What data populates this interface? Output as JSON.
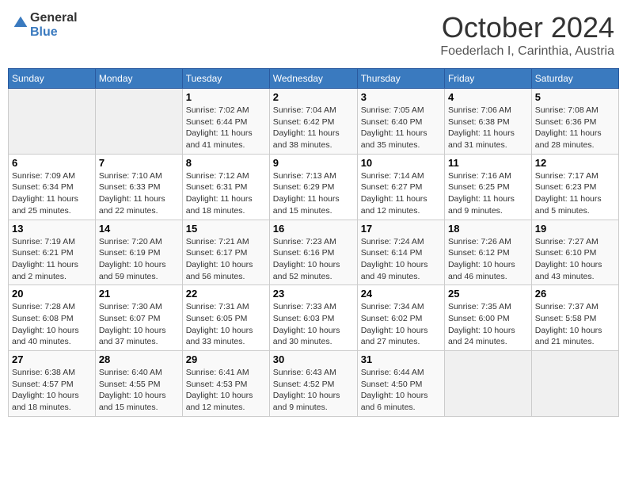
{
  "header": {
    "logo_general": "General",
    "logo_blue": "Blue",
    "month_title": "October 2024",
    "location": "Foederlach I, Carinthia, Austria"
  },
  "weekdays": [
    "Sunday",
    "Monday",
    "Tuesday",
    "Wednesday",
    "Thursday",
    "Friday",
    "Saturday"
  ],
  "weeks": [
    [
      {
        "day": "",
        "empty": true
      },
      {
        "day": "",
        "empty": true
      },
      {
        "day": "1",
        "sunrise": "Sunrise: 7:02 AM",
        "sunset": "Sunset: 6:44 PM",
        "daylight": "Daylight: 11 hours and 41 minutes."
      },
      {
        "day": "2",
        "sunrise": "Sunrise: 7:04 AM",
        "sunset": "Sunset: 6:42 PM",
        "daylight": "Daylight: 11 hours and 38 minutes."
      },
      {
        "day": "3",
        "sunrise": "Sunrise: 7:05 AM",
        "sunset": "Sunset: 6:40 PM",
        "daylight": "Daylight: 11 hours and 35 minutes."
      },
      {
        "day": "4",
        "sunrise": "Sunrise: 7:06 AM",
        "sunset": "Sunset: 6:38 PM",
        "daylight": "Daylight: 11 hours and 31 minutes."
      },
      {
        "day": "5",
        "sunrise": "Sunrise: 7:08 AM",
        "sunset": "Sunset: 6:36 PM",
        "daylight": "Daylight: 11 hours and 28 minutes."
      }
    ],
    [
      {
        "day": "6",
        "sunrise": "Sunrise: 7:09 AM",
        "sunset": "Sunset: 6:34 PM",
        "daylight": "Daylight: 11 hours and 25 minutes."
      },
      {
        "day": "7",
        "sunrise": "Sunrise: 7:10 AM",
        "sunset": "Sunset: 6:33 PM",
        "daylight": "Daylight: 11 hours and 22 minutes."
      },
      {
        "day": "8",
        "sunrise": "Sunrise: 7:12 AM",
        "sunset": "Sunset: 6:31 PM",
        "daylight": "Daylight: 11 hours and 18 minutes."
      },
      {
        "day": "9",
        "sunrise": "Sunrise: 7:13 AM",
        "sunset": "Sunset: 6:29 PM",
        "daylight": "Daylight: 11 hours and 15 minutes."
      },
      {
        "day": "10",
        "sunrise": "Sunrise: 7:14 AM",
        "sunset": "Sunset: 6:27 PM",
        "daylight": "Daylight: 11 hours and 12 minutes."
      },
      {
        "day": "11",
        "sunrise": "Sunrise: 7:16 AM",
        "sunset": "Sunset: 6:25 PM",
        "daylight": "Daylight: 11 hours and 9 minutes."
      },
      {
        "day": "12",
        "sunrise": "Sunrise: 7:17 AM",
        "sunset": "Sunset: 6:23 PM",
        "daylight": "Daylight: 11 hours and 5 minutes."
      }
    ],
    [
      {
        "day": "13",
        "sunrise": "Sunrise: 7:19 AM",
        "sunset": "Sunset: 6:21 PM",
        "daylight": "Daylight: 11 hours and 2 minutes."
      },
      {
        "day": "14",
        "sunrise": "Sunrise: 7:20 AM",
        "sunset": "Sunset: 6:19 PM",
        "daylight": "Daylight: 10 hours and 59 minutes."
      },
      {
        "day": "15",
        "sunrise": "Sunrise: 7:21 AM",
        "sunset": "Sunset: 6:17 PM",
        "daylight": "Daylight: 10 hours and 56 minutes."
      },
      {
        "day": "16",
        "sunrise": "Sunrise: 7:23 AM",
        "sunset": "Sunset: 6:16 PM",
        "daylight": "Daylight: 10 hours and 52 minutes."
      },
      {
        "day": "17",
        "sunrise": "Sunrise: 7:24 AM",
        "sunset": "Sunset: 6:14 PM",
        "daylight": "Daylight: 10 hours and 49 minutes."
      },
      {
        "day": "18",
        "sunrise": "Sunrise: 7:26 AM",
        "sunset": "Sunset: 6:12 PM",
        "daylight": "Daylight: 10 hours and 46 minutes."
      },
      {
        "day": "19",
        "sunrise": "Sunrise: 7:27 AM",
        "sunset": "Sunset: 6:10 PM",
        "daylight": "Daylight: 10 hours and 43 minutes."
      }
    ],
    [
      {
        "day": "20",
        "sunrise": "Sunrise: 7:28 AM",
        "sunset": "Sunset: 6:08 PM",
        "daylight": "Daylight: 10 hours and 40 minutes."
      },
      {
        "day": "21",
        "sunrise": "Sunrise: 7:30 AM",
        "sunset": "Sunset: 6:07 PM",
        "daylight": "Daylight: 10 hours and 37 minutes."
      },
      {
        "day": "22",
        "sunrise": "Sunrise: 7:31 AM",
        "sunset": "Sunset: 6:05 PM",
        "daylight": "Daylight: 10 hours and 33 minutes."
      },
      {
        "day": "23",
        "sunrise": "Sunrise: 7:33 AM",
        "sunset": "Sunset: 6:03 PM",
        "daylight": "Daylight: 10 hours and 30 minutes."
      },
      {
        "day": "24",
        "sunrise": "Sunrise: 7:34 AM",
        "sunset": "Sunset: 6:02 PM",
        "daylight": "Daylight: 10 hours and 27 minutes."
      },
      {
        "day": "25",
        "sunrise": "Sunrise: 7:35 AM",
        "sunset": "Sunset: 6:00 PM",
        "daylight": "Daylight: 10 hours and 24 minutes."
      },
      {
        "day": "26",
        "sunrise": "Sunrise: 7:37 AM",
        "sunset": "Sunset: 5:58 PM",
        "daylight": "Daylight: 10 hours and 21 minutes."
      }
    ],
    [
      {
        "day": "27",
        "sunrise": "Sunrise: 6:38 AM",
        "sunset": "Sunset: 4:57 PM",
        "daylight": "Daylight: 10 hours and 18 minutes."
      },
      {
        "day": "28",
        "sunrise": "Sunrise: 6:40 AM",
        "sunset": "Sunset: 4:55 PM",
        "daylight": "Daylight: 10 hours and 15 minutes."
      },
      {
        "day": "29",
        "sunrise": "Sunrise: 6:41 AM",
        "sunset": "Sunset: 4:53 PM",
        "daylight": "Daylight: 10 hours and 12 minutes."
      },
      {
        "day": "30",
        "sunrise": "Sunrise: 6:43 AM",
        "sunset": "Sunset: 4:52 PM",
        "daylight": "Daylight: 10 hours and 9 minutes."
      },
      {
        "day": "31",
        "sunrise": "Sunrise: 6:44 AM",
        "sunset": "Sunset: 4:50 PM",
        "daylight": "Daylight: 10 hours and 6 minutes."
      },
      {
        "day": "",
        "empty": true
      },
      {
        "day": "",
        "empty": true
      }
    ]
  ]
}
